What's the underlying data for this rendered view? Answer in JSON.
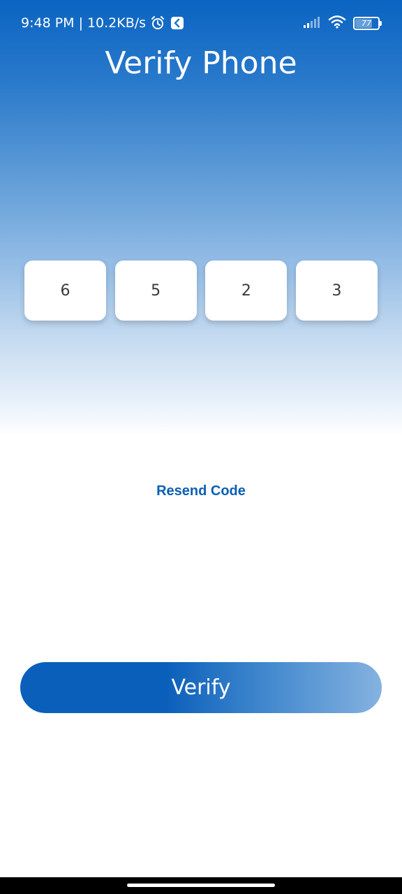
{
  "status_bar": {
    "time": "9:48 PM",
    "separator": "|",
    "network_speed": "10.2KB/s",
    "battery_level": "77",
    "icons": [
      "alarm-icon",
      "app-notification-icon",
      "signal-icon",
      "wifi-icon",
      "battery-icon"
    ]
  },
  "page": {
    "title": "Verify Phone"
  },
  "code": {
    "digits": [
      "6",
      "5",
      "2",
      "3"
    ]
  },
  "actions": {
    "resend_label": "Resend Code",
    "verify_label": "Verify"
  },
  "colors": {
    "primary_blue": "#0a5fba",
    "link_blue": "#0a5fb2",
    "white": "#ffffff"
  }
}
